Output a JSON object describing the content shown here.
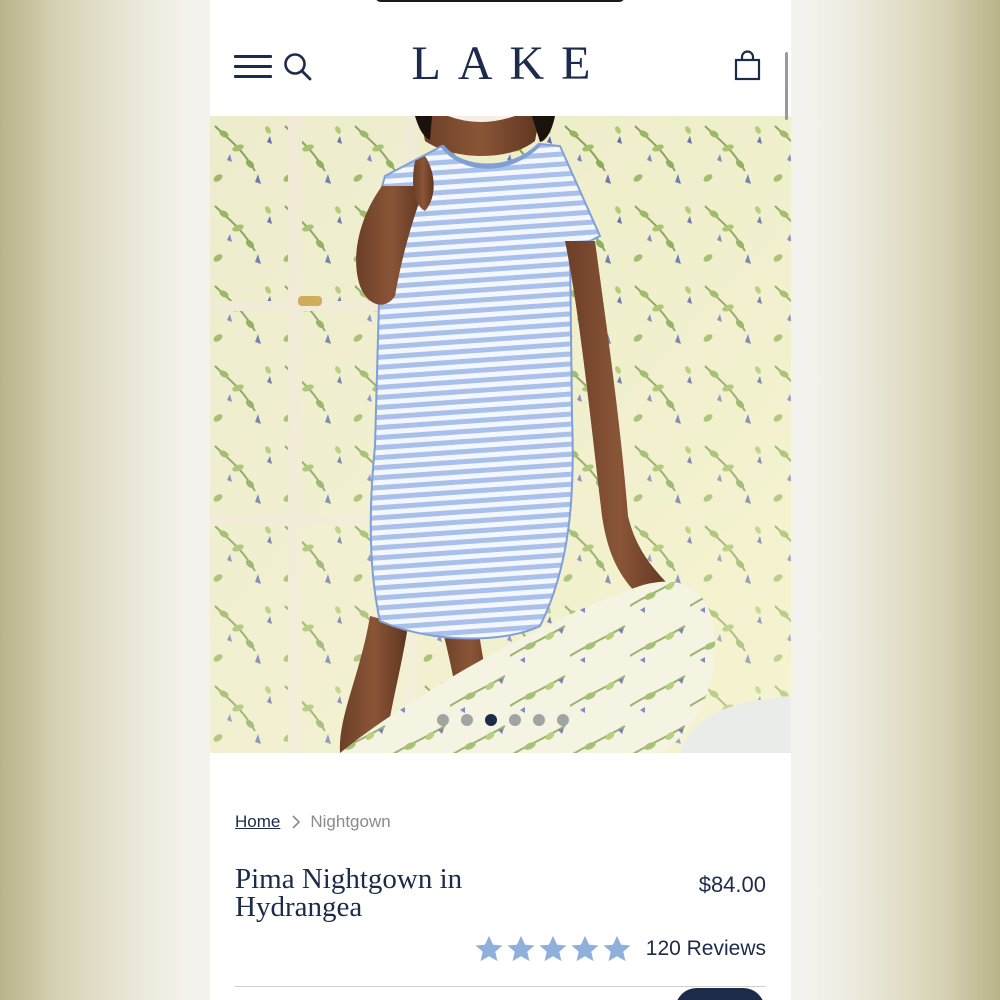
{
  "header": {
    "logo": "LAKE",
    "menu_icon": "hamburger-menu-icon",
    "search_icon": "search-icon",
    "bag_icon": "shopping-bag-icon"
  },
  "hero": {
    "image_alt": "Woman wearing a blue and white striped short-sleeve nightgown standing beside a floral sofa",
    "carousel_count": 6,
    "carousel_active_index": 2
  },
  "breadcrumb": {
    "home": "Home",
    "current": "Nightgown"
  },
  "product": {
    "title": "Pima Nightgown in Hydrangea",
    "price": "$84.00",
    "rating": 5,
    "rating_max": 5,
    "reviews_label": "120 Reviews"
  },
  "colors": {
    "navy": "#1d2b4a",
    "star": "#8fb0da",
    "dress_blue": "#a9c1ea"
  }
}
